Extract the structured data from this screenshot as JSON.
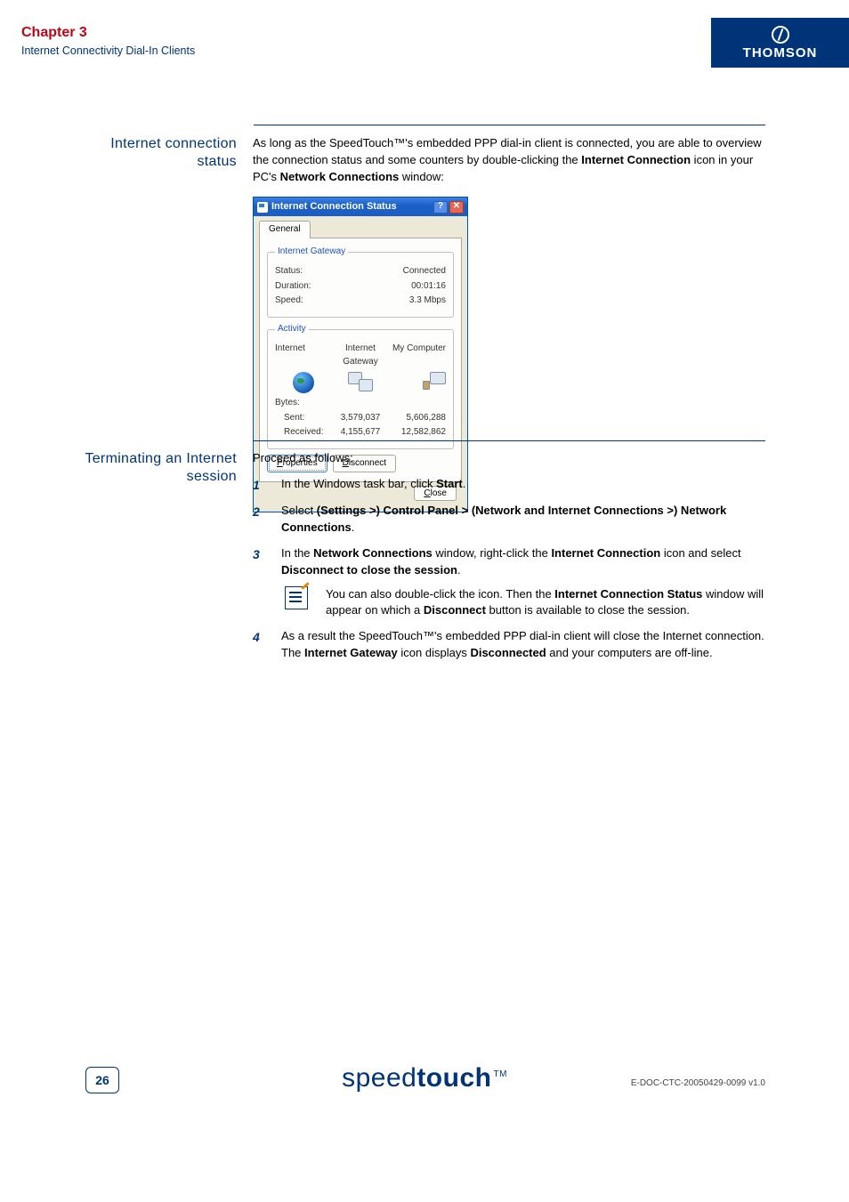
{
  "header": {
    "chapter_title": "Chapter 3",
    "chapter_sub": "Internet Connectivity Dial-In Clients",
    "brand": "THOMSON"
  },
  "section1": {
    "label_line1": "Internet connection",
    "label_line2": "status",
    "para_pre": "As long as the SpeedTouch™'s embedded PPP dial-in client is connected, you are able to overview the connection status and some counters by double-clicking the ",
    "para_bold1": "Internet Connection",
    "para_mid": " icon in your PC's ",
    "para_bold2": "Network Connections",
    "para_post": " window:"
  },
  "dialog": {
    "title": "Internet Connection Status",
    "help": "?",
    "close_x": "✕",
    "tab_general": "General",
    "group_gateway": "Internet Gateway",
    "status_label": "Status:",
    "status_value": "Connected",
    "duration_label": "Duration:",
    "duration_value": "00:01:16",
    "speed_label": "Speed:",
    "speed_value": "3.3 Mbps",
    "group_activity": "Activity",
    "col_internet": "Internet",
    "col_gateway": "Internet Gateway",
    "col_mycomputer": "My Computer",
    "bytes_label": "Bytes:",
    "sent_label": "Sent:",
    "sent_gw": "3,579,037",
    "sent_pc": "5,606,288",
    "recv_label": "Received:",
    "recv_gw": "4,155,677",
    "recv_pc": "12,582,862",
    "btn_properties_u": "P",
    "btn_properties_rest": "roperties",
    "btn_disconnect_u": "D",
    "btn_disconnect_rest": "isconnect",
    "btn_close_u": "C",
    "btn_close_rest": "lose"
  },
  "section2": {
    "label_line1": "Terminating an Internet",
    "label_line2": "session",
    "intro": "Proceed as follows:",
    "items": [
      {
        "num": "1",
        "pre": "In the Windows task bar, click ",
        "b1": "Start",
        "post": "."
      },
      {
        "num": "2",
        "pre": "Select ",
        "b1": "(Settings >) Control Panel > (Network and Internet Connections >) Network Connections",
        "post": "."
      },
      {
        "num": "3",
        "pre": "In the ",
        "b1": "Network Connections",
        "mid1": " window, right-click the ",
        "b2": "Internet Connection",
        "mid2": " icon and select ",
        "b3": "Disconnect to close the session",
        "post": "."
      },
      {
        "num": "4",
        "pre": "As a result the SpeedTouch™'s embedded PPP dial-in client will close the Internet connection. The ",
        "b1": "Internet Gateway",
        "mid1": " icon displays ",
        "b2": "Disconnected",
        "post": " and your computers are off-line."
      }
    ],
    "note_pre": "You can also double-click the icon. Then the ",
    "note_b1": "Internet Connection Status",
    "note_mid": " window will appear on which a ",
    "note_b2": "Disconnect",
    "note_post": " button is available to close the session."
  },
  "footer": {
    "page": "26",
    "logo_thin": "speed",
    "logo_bold": "touch",
    "tm": "TM",
    "docid": "E-DOC-CTC-20050429-0099 v1.0"
  }
}
